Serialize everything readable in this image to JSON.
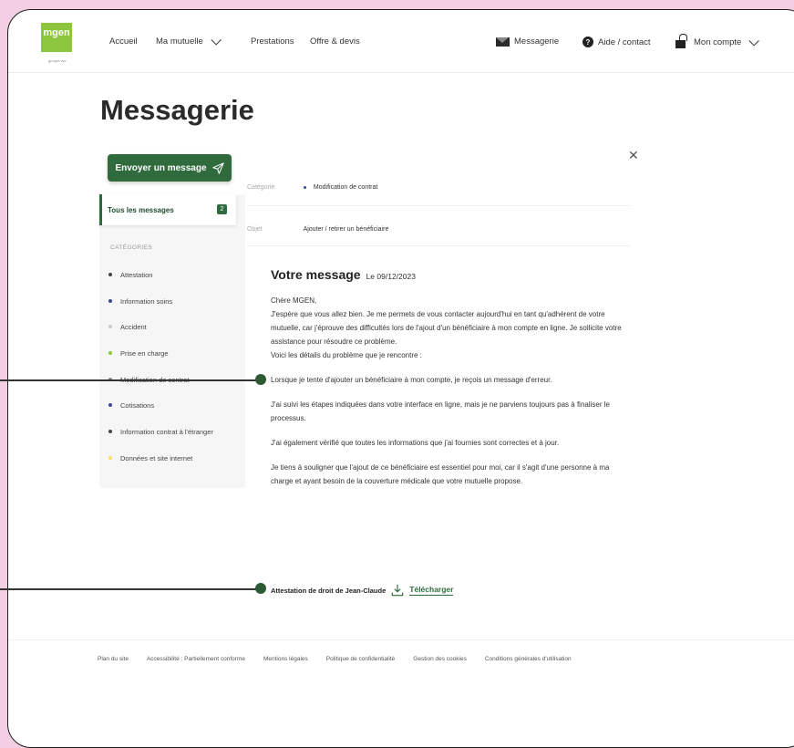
{
  "nav": {
    "logo_text": "mgen",
    "logo_sub": "groupe vyv",
    "items": [
      {
        "label": "Accueil"
      },
      {
        "label": "Ma mutuelle"
      },
      {
        "label": "Prestations"
      },
      {
        "label": "Offre & devis"
      }
    ],
    "messagerie": "Messagerie",
    "aide": "Aide / contact",
    "compte": "Mon compte"
  },
  "page_title": "Messagerie",
  "sidebar": {
    "send_button": "Envoyer un message",
    "all_messages": "Tous les messages",
    "all_count": "2",
    "categories_title": "CATÉGORIES",
    "categories": [
      {
        "label": "Attestation",
        "color": "#444444"
      },
      {
        "label": "Information soins",
        "color": "#3a4a8f"
      },
      {
        "label": "Accident",
        "color": "#cccccc"
      },
      {
        "label": "Prise en charge",
        "color": "#8cc63f"
      },
      {
        "label": "Modification de contrat",
        "color": "#8a8a8a"
      },
      {
        "label": "Cotisations",
        "color": "#3a4a8f"
      },
      {
        "label": "Information contrat à l'étranger",
        "color": "#444444"
      },
      {
        "label": "Données et site internet",
        "color": "#f5e06a"
      }
    ]
  },
  "message": {
    "category_label": "Catégorie",
    "category_value": "Modification de contrat",
    "category_color": "#3a4a8f",
    "subject_label": "Objet",
    "subject_value": "Ajouter / retirer un bénéficiaire",
    "title": "Votre message",
    "date": "Le 09/12/2023",
    "paragraphs": [
      "Chère MGEN,\nJ'espère que vous allez bien. Je me permets de vous contacter aujourd'hui en tant qu'adhérent de votre mutuelle, car j'éprouve des difficultés lors de l'ajout d'un bénéficiaire à mon compte en ligne. Je sollicite votre assistance pour résoudre ce problème.\nVoici les détails du problème que je rencontre :",
      "Lorsque je tente d'ajouter un bénéficiaire à mon compte, je reçois un message d'erreur.",
      "J'ai suivi les étapes indiquées dans votre interface en ligne, mais je ne parviens toujours pas à finaliser le processus.",
      "J'ai également vérifié que toutes les informations que j'ai fournies sont correctes et à jour.",
      "Je tiens à souligner que l'ajout de ce bénéficiaire est essentiel pour moi, car il s'agit d'une personne à ma charge et ayant besoin de la couverture médicale que votre mutuelle propose."
    ],
    "attachment_name": "Attestation de droit de Jean-Claude",
    "download_label": "Télécharger"
  },
  "footer": [
    {
      "label": "Plan du site"
    },
    {
      "label": "Accessibilité : Partiellement conforme"
    },
    {
      "label": "Mentions légales"
    },
    {
      "label": "Politique de confidentialité"
    },
    {
      "label": "Gestion des cookies"
    },
    {
      "label": "Conditions générales d'utilisation"
    }
  ],
  "colors": {
    "brand_green": "#2f6b3c",
    "logo_green": "#8cc63f",
    "background_pink": "#f2cfe3"
  }
}
